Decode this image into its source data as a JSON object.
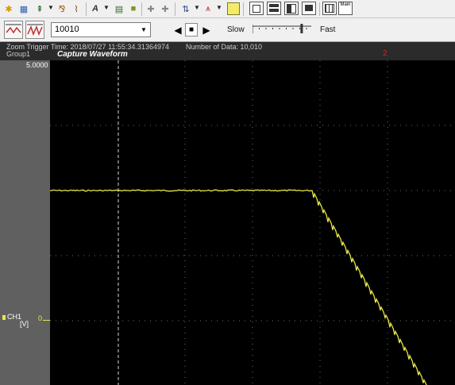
{
  "toolbar": {
    "icons": [
      "search-wave-icon",
      "channel-config-icon",
      "marker-icon",
      "trigger-icon",
      "cursor-icon",
      "text-annotation-icon",
      "copy-icon",
      "color-icon",
      "group-plus-icon",
      "group-minus-icon",
      "arrow-icon",
      "waveform-add-icon",
      "yellow-panel-icon",
      "layout-1-icon",
      "layout-2-icon",
      "layout-3-icon",
      "layout-4-icon",
      "table-icon",
      "main-window-icon"
    ],
    "main_label": "Main"
  },
  "controls": {
    "record_count_value": "10010",
    "speed_slow_label": "Slow",
    "speed_fast_label": "Fast",
    "speed_level": 0.85
  },
  "info": {
    "zoom_trigger_time": "Zoom Trigger Time: 2018/07/27 11:55:34.31364974",
    "number_of_data": "Number of Data: 10,010",
    "group": "Group1",
    "title": "Capture Waveform",
    "marker_label": "2"
  },
  "axis": {
    "y_top_label": "5.0000",
    "channel_name": "CH1",
    "channel_unit": "[V]",
    "zero_label": "0"
  },
  "colors": {
    "trace": "#e6e64a",
    "grid": "#6a6a6a",
    "cursor": "#d8d8d8",
    "marker": "#e02020"
  }
}
